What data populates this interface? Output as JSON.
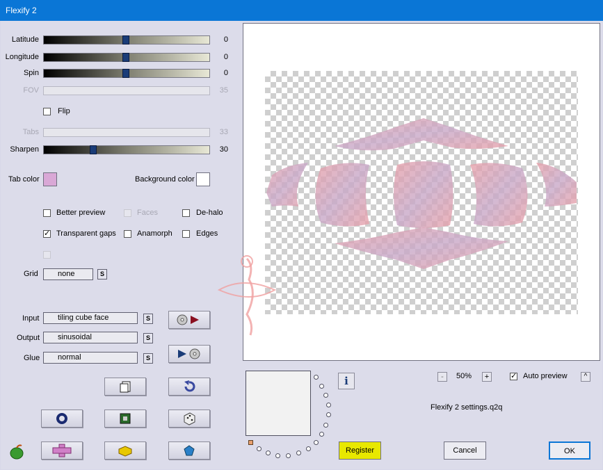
{
  "window": {
    "title": "Flexify 2"
  },
  "sliders": [
    {
      "label": "Latitude",
      "value": "0",
      "level": 0.5,
      "disabled": false
    },
    {
      "label": "Longitude",
      "value": "0",
      "level": 0.5,
      "disabled": false
    },
    {
      "label": "Spin",
      "value": "0",
      "level": 0.5,
      "disabled": false
    },
    {
      "label": "FOV",
      "value": "35",
      "level": null,
      "disabled": true
    },
    {
      "label": "Tabs",
      "value": "33",
      "level": null,
      "disabled": true
    },
    {
      "label": "Sharpen",
      "value": "30",
      "level": 0.3,
      "disabled": false
    }
  ],
  "flip": {
    "label": "Flip",
    "checked": false
  },
  "tab_color": {
    "label": "Tab color",
    "color": "#d9a8d6"
  },
  "background_color": {
    "label": "Background color",
    "color": "#ffffff"
  },
  "options": {
    "better_preview": {
      "label": "Better preview",
      "checked": false
    },
    "faces": {
      "label": "Faces",
      "checked": false,
      "disabled": true
    },
    "de_halo": {
      "label": "De-halo",
      "checked": false
    },
    "transparent_gaps": {
      "label": "Transparent gaps",
      "checked": true
    },
    "anamorph": {
      "label": "Anamorph",
      "checked": false
    },
    "edges": {
      "label": "Edges",
      "checked": false
    }
  },
  "grid": {
    "label": "Grid",
    "value": "none",
    "s": "S"
  },
  "input": {
    "label": "Input",
    "value": "tiling cube face",
    "s": "S"
  },
  "output": {
    "label": "Output",
    "value": "sinusoidal",
    "s": "S"
  },
  "glue": {
    "label": "Glue",
    "value": "normal",
    "s": "S"
  },
  "zoom": {
    "minus": "-",
    "value": "50%",
    "plus": "+"
  },
  "auto_preview": {
    "label": "Auto preview",
    "checked": true,
    "arrow": "^"
  },
  "settings_file": "Flexify 2 settings.q2q",
  "info": "i",
  "buttons": {
    "register": "Register",
    "cancel": "Cancel",
    "ok": "OK"
  },
  "colors": {
    "register_bg": "#e8e800",
    "accent": "#0a76d6"
  }
}
